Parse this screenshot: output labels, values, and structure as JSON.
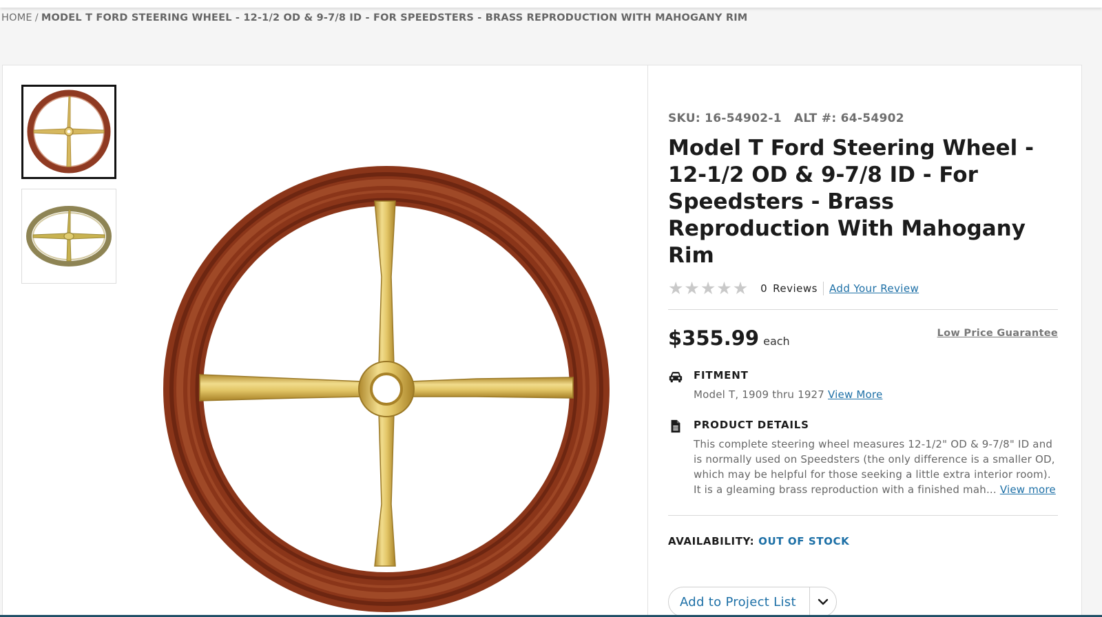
{
  "breadcrumb": {
    "home": "HOME",
    "separator": "/",
    "current": "MODEL T FORD STEERING WHEEL - 12-1/2 OD & 9-7/8 ID - FOR SPEEDSTERS - BRASS REPRODUCTION WITH MAHOGANY RIM"
  },
  "gallery": {
    "thumbnails": [
      {
        "icon": "steering-wheel-front-image",
        "selected": true
      },
      {
        "icon": "steering-wheel-angled-image",
        "selected": false
      }
    ],
    "main_image": "steering-wheel-image"
  },
  "product": {
    "sku_label": "SKU: 16-54902-1",
    "alt_label": "ALT #: 64-54902",
    "title": "Model T Ford Steering Wheel - 12-1/2 OD & 9-7/8 ID - For Speedsters - Brass Reproduction With Mahogany Rim",
    "rating": {
      "stars_filled": 0,
      "stars_total": 5,
      "count": "0",
      "reviews_label": "Reviews",
      "add_review": "Add Your Review"
    },
    "price": "$355.99",
    "price_unit": "each",
    "low_price_guarantee": "Low Price Guarantee",
    "fitment": {
      "heading": "FITMENT",
      "text": "Model T, 1909 thru 1927",
      "link": "View More",
      "icon": "car-icon"
    },
    "details": {
      "heading": "PRODUCT DETAILS",
      "text": "This complete steering wheel measures 12-1/2\" OD & 9-7/8\" ID and is normally used on Speedsters (the only difference is a smaller OD, which may be helpful for those seeking a little extra interior room). It is a gleaming brass reproduction with a finished mah...",
      "link": "View more",
      "icon": "document-icon"
    },
    "availability": {
      "label": "AVAILABILITY:",
      "status": "OUT OF STOCK"
    },
    "project_list_button": "Add to Project List"
  },
  "colors": {
    "link": "#1c6fa6",
    "mahogany": "#9b3d22",
    "brass": "#d8b85a",
    "star_empty": "#c9c9c9"
  }
}
